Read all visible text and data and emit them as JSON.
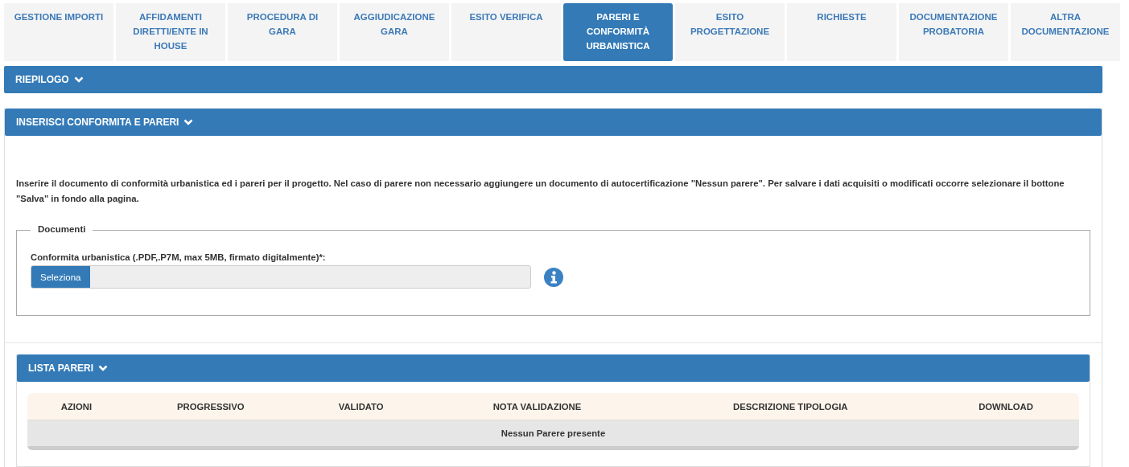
{
  "tabs": [
    {
      "label": "GESTIONE IMPORTI",
      "selected": false
    },
    {
      "label": "AFFIDAMENTI DIRETTI/ENTE IN HOUSE",
      "selected": false
    },
    {
      "label": "PROCEDURA DI GARA",
      "selected": false
    },
    {
      "label": "AGGIUDICAZIONE GARA",
      "selected": false
    },
    {
      "label": "ESITO VERIFICA",
      "selected": false
    },
    {
      "label": "PARERI E CONFORMITÀ URBANISTICA",
      "selected": true
    },
    {
      "label": "ESITO PROGETTAZIONE",
      "selected": false
    },
    {
      "label": "RICHIESTE",
      "selected": false
    },
    {
      "label": "DOCUMENTAZIONE PROBATORIA",
      "selected": false
    },
    {
      "label": "ALTRA DOCUMENTAZIONE",
      "selected": false
    }
  ],
  "summary_panel": {
    "title": "RIEPILOGO"
  },
  "insert_panel": {
    "title": "INSERISCI CONFORMITA E PARERI",
    "instructions": "Inserire il documento di conformità urbanistica ed i pareri per il progetto. Nel caso di parere non necessario aggiungere un documento di autocertificazione \"Nessun parere\". Per salvare i dati acquisiti o modificati occorre selezionare il bottone \"Salva\" in fondo alla pagina.",
    "fieldset": {
      "legend": "Documenti",
      "field_label": "Conformita urbanistica (.PDF,.P7M, max 5MB, firmato digitalmente)*:",
      "button": "Seleziona"
    }
  },
  "opinions_panel": {
    "title": "LISTA PARERI",
    "table": {
      "columns": [
        "AZIONI",
        "PROGRESSIVO",
        "VALIDATO",
        "NOTA VALIDAZIONE",
        "DESCRIZIONE TIPOLOGIA",
        "DOWNLOAD"
      ],
      "empty_message": "Nessun Parere presente"
    }
  }
}
